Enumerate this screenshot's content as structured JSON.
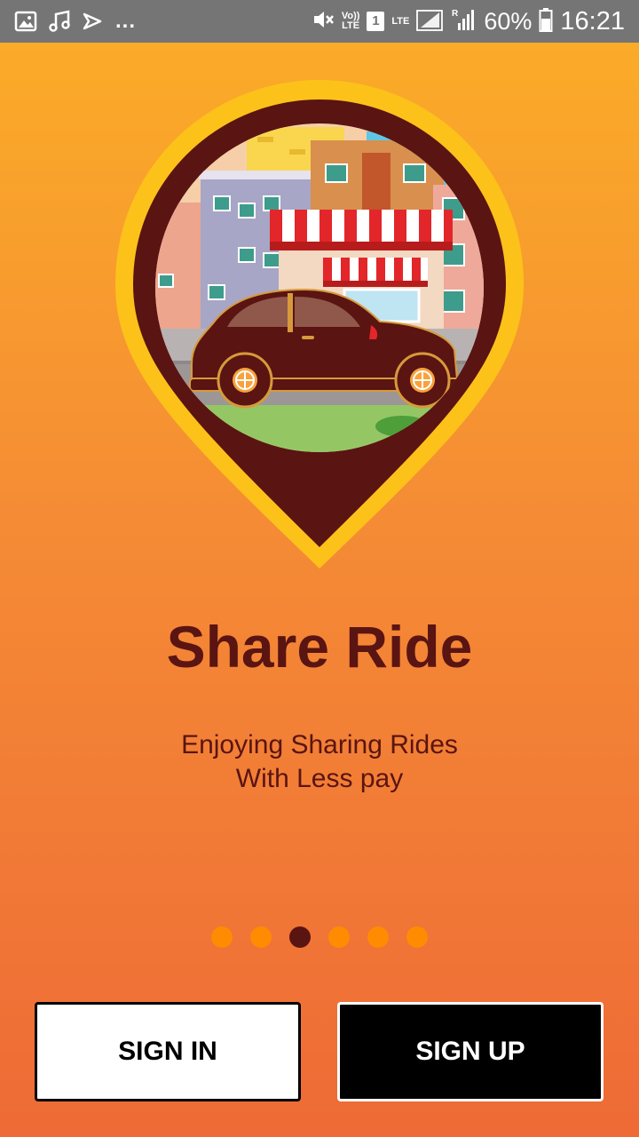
{
  "status_bar": {
    "icons_left": [
      "image-icon",
      "music-note-icon",
      "download-done-icon"
    ],
    "more": "...",
    "volte": [
      "Vo))",
      "LTE"
    ],
    "sim_slot": "1",
    "network": "LTE",
    "roaming": "R",
    "battery": "60%",
    "time": "16:21"
  },
  "onboarding": {
    "title": "Share Ride",
    "subtitle_line1": "Enjoying Sharing Rides",
    "subtitle_line2": "With Less pay",
    "pages_total": 6,
    "active_page": 3
  },
  "actions": {
    "sign_in_label": "SIGN IN",
    "sign_up_label": "SIGN UP"
  },
  "colors": {
    "accent_dark": "#5A1412",
    "dot_inactive": "#FF8C00",
    "gradient_top": "#FBAE26",
    "gradient_bottom": "#EE6A36"
  }
}
